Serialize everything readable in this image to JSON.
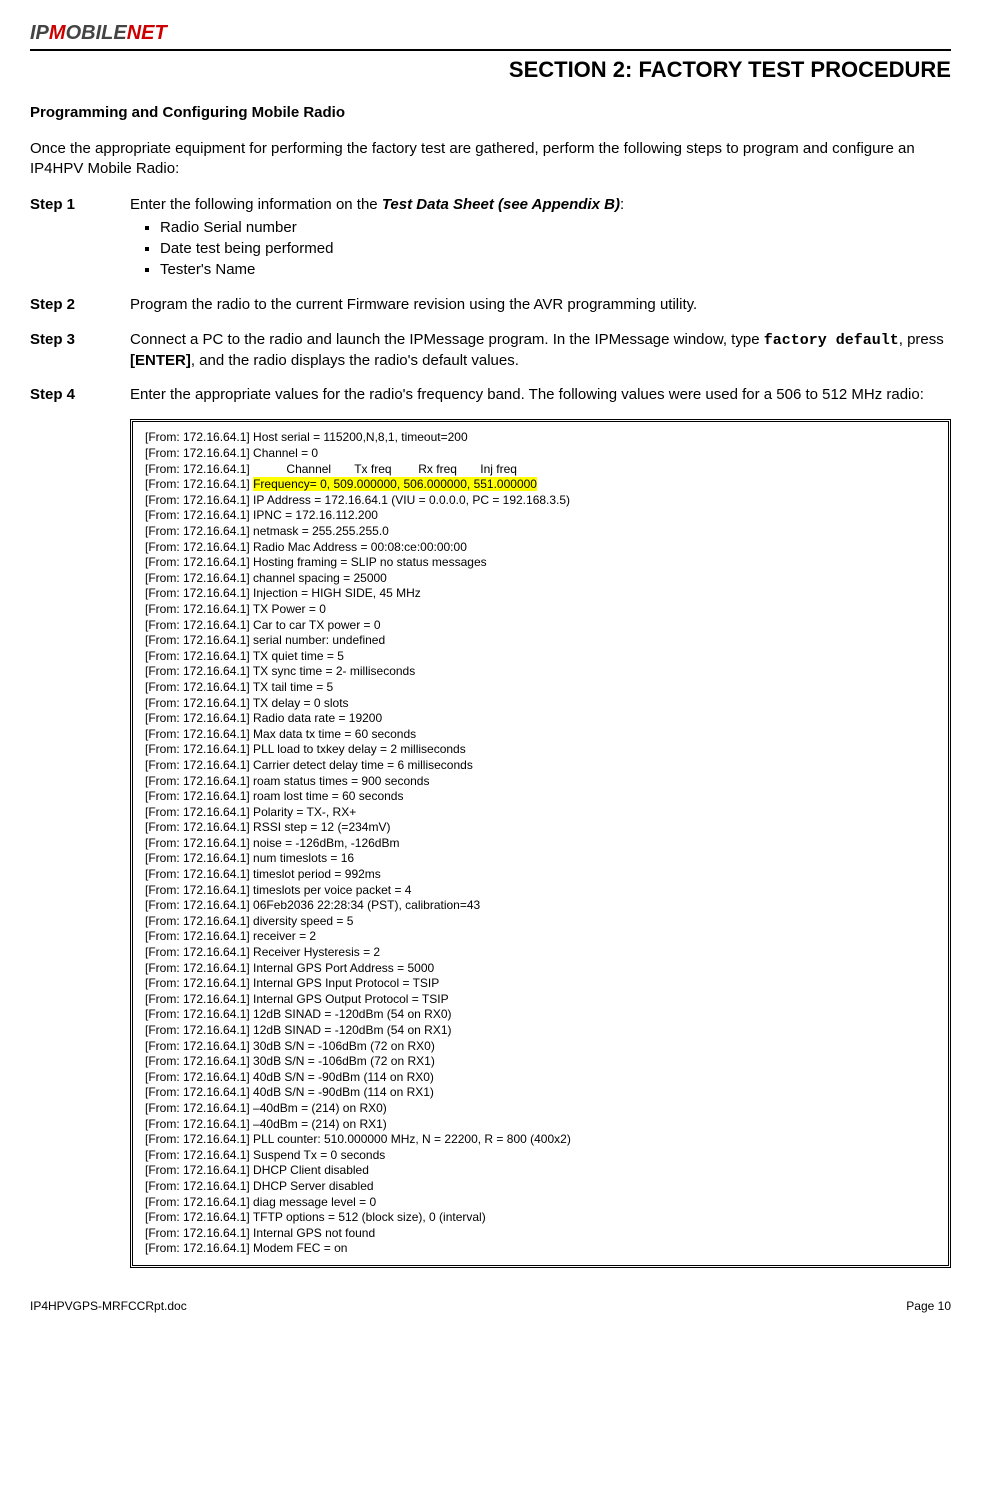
{
  "header": {
    "logo_prefix": "IP",
    "logo_mid": "M",
    "logo_rest": "OBILE",
    "logo_suffix": "NET",
    "section_title": "SECTION 2:  FACTORY TEST PROCEDURE"
  },
  "subtitle": "Programming and Configuring Mobile Radio",
  "intro": "Once the appropriate equipment for performing the factory test are gathered, perform the following steps to program and configure an IP4HPV Mobile Radio:",
  "steps": [
    {
      "label": "Step 1",
      "lead": "Enter the following information on the ",
      "lead_emph": "Test Data Sheet (see Appendix B)",
      "lead_tail": ":",
      "bullets": [
        "Radio Serial number",
        "Date test being performed",
        "Tester's Name"
      ]
    },
    {
      "label": "Step 2",
      "body": "Program the radio to the current Firmware revision using the AVR programming utility."
    },
    {
      "label": "Step 3",
      "body_pre": "Connect a PC to the radio and launch the IPMessage program.  In the IPMessage window, type ",
      "code": "factory default",
      "body_mid": ", press ",
      "enter": "[ENTER]",
      "body_post": ", and the radio displays the radio's default values."
    },
    {
      "label": "Step 4",
      "body": "Enter the appropriate values for the radio's frequency band.  The following values were used for a 506 to 512 MHz radio:"
    }
  ],
  "terminal": {
    "lines": [
      "[From: 172.16.64.1] Host serial = 115200,N,8,1, timeout=200",
      "[From: 172.16.64.1] Channel = 0",
      "[From: 172.16.64.1]           Channel       Tx freq        Rx freq       Inj freq",
      "[From: 172.16.64.1] IP Address = 172.16.64.1 (VIU = 0.0.0.0, PC = 192.168.3.5)",
      "[From: 172.16.64.1] IPNC = 172.16.112.200",
      "[From: 172.16.64.1] netmask = 255.255.255.0",
      "[From: 172.16.64.1] Radio Mac Address = 00:08:ce:00:00:00",
      "[From: 172.16.64.1] Hosting framing = SLIP no status messages",
      "[From: 172.16.64.1] channel spacing = 25000",
      "[From: 172.16.64.1] Injection = HIGH SIDE, 45 MHz",
      "[From: 172.16.64.1] TX Power = 0",
      "[From: 172.16.64.1] Car to car TX power = 0",
      "[From: 172.16.64.1] serial number: undefined",
      "[From: 172.16.64.1] TX quiet time = 5",
      "[From: 172.16.64.1] TX sync time = 2- milliseconds",
      "[From: 172.16.64.1] TX tail time = 5",
      "[From: 172.16.64.1] TX delay = 0 slots",
      "[From: 172.16.64.1] Radio data rate = 19200",
      "[From: 172.16.64.1] Max data tx time = 60 seconds",
      "[From: 172.16.64.1] PLL load to txkey delay = 2 milliseconds",
      "[From: 172.16.64.1] Carrier detect delay time = 6 milliseconds",
      "[From: 172.16.64.1] roam status times = 900 seconds",
      "[From: 172.16.64.1] roam lost time = 60 seconds",
      "[From: 172.16.64.1] Polarity = TX-, RX+",
      "[From: 172.16.64.1] RSSI step = 12 (=234mV)",
      "[From: 172.16.64.1] noise = -126dBm, -126dBm",
      "[From: 172.16.64.1] num timeslots = 16",
      "[From: 172.16.64.1] timeslot period = 992ms",
      "[From: 172.16.64.1] timeslots per voice packet = 4",
      "[From: 172.16.64.1] 06Feb2036 22:28:34 (PST), calibration=43",
      "[From: 172.16.64.1] diversity speed = 5",
      "[From: 172.16.64.1] receiver = 2",
      "[From: 172.16.64.1] Receiver Hysteresis = 2",
      "[From: 172.16.64.1] Internal GPS Port Address = 5000",
      "[From: 172.16.64.1] Internal GPS Input Protocol = TSIP",
      "[From: 172.16.64.1] Internal GPS Output Protocol = TSIP",
      "[From: 172.16.64.1] 12dB SINAD = -120dBm (54 on RX0)",
      "[From: 172.16.64.1] 12dB SINAD = -120dBm (54 on RX1)",
      "[From: 172.16.64.1] 30dB S/N = -106dBm (72 on RX0)",
      "[From: 172.16.64.1] 30dB S/N = -106dBm (72 on RX1)",
      "[From: 172.16.64.1] 40dB S/N = -90dBm (114 on RX0)",
      "[From: 172.16.64.1] 40dB S/N = -90dBm (114 on RX1)",
      "[From: 172.16.64.1] –40dBm = (214) on RX0)",
      "[From: 172.16.64.1] –40dBm = (214) on RX1)",
      "[From: 172.16.64.1] PLL counter: 510.000000 MHz, N = 22200, R = 800 (400x2)",
      "[From: 172.16.64.1] Suspend Tx = 0 seconds",
      "[From: 172.16.64.1] DHCP Client disabled",
      "[From: 172.16.64.1] DHCP Server disabled",
      "[From: 172.16.64.1] diag message level = 0",
      "[From: 172.16.64.1] TFTP options = 512 (block size), 0 (interval)",
      "[From: 172.16.64.1] Internal GPS not found",
      "[From: 172.16.64.1] Modem FEC = on"
    ],
    "highlight_line_prefix": "[From: 172.16.64.1] ",
    "highlight_text": "Frequency= 0, 509.000000, 506.000000, 551.000000",
    "highlight_insert_after": 2
  },
  "footer": {
    "left": "IP4HPVGPS-MRFCCRpt.doc",
    "right": "Page 10"
  }
}
